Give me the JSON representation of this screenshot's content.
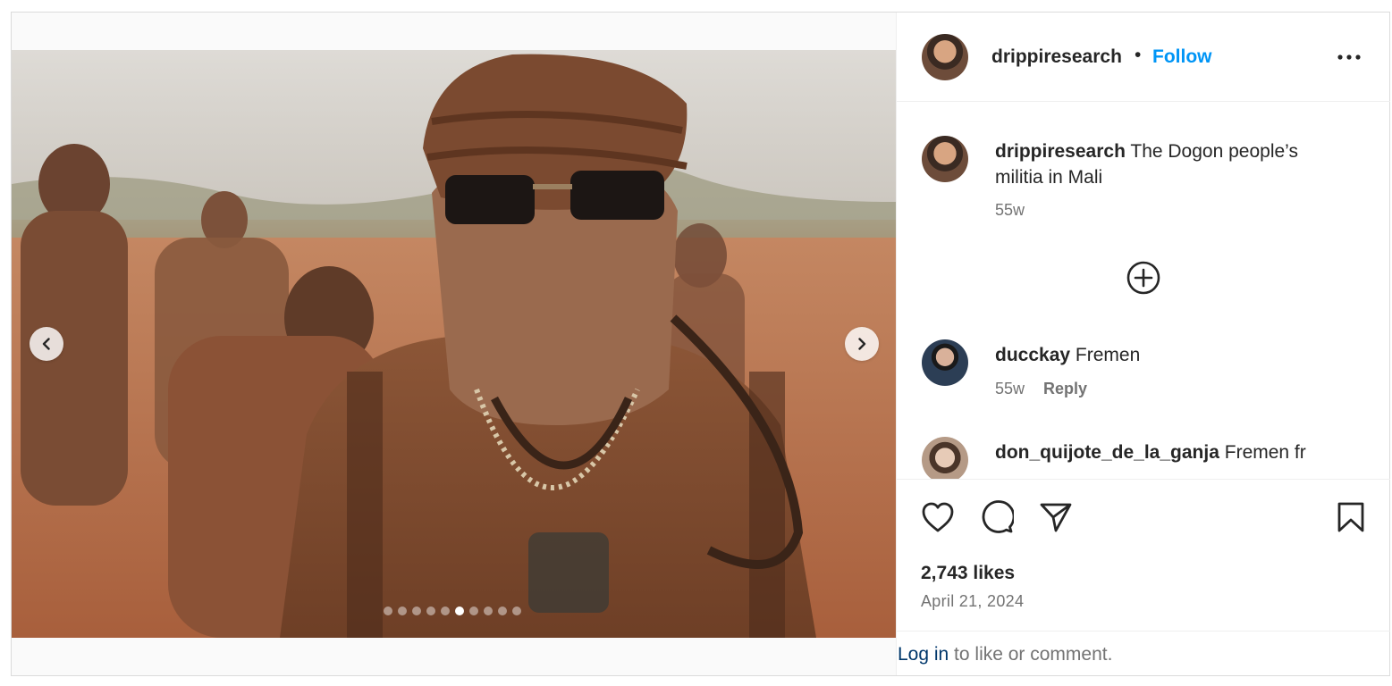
{
  "post": {
    "author": "drippiresearch",
    "separator": "•",
    "follow_label": "Follow",
    "caption": {
      "username": "drippiresearch",
      "text": "The Dogon people’s militia in Mali",
      "time": "55w"
    },
    "comments": [
      {
        "username": "ducckay",
        "text": "Fremen",
        "time": "55w",
        "reply_label": "Reply"
      },
      {
        "username": "don_quijote_de_la_ganja",
        "text": "Fremen fr"
      }
    ],
    "likes": "2,743 likes",
    "date": "April 21, 2024",
    "login_link": "Log in",
    "login_text": " to like or comment.",
    "carousel": {
      "slide_count": 10,
      "active_index": 5
    }
  },
  "icons": {
    "prev": "chevron-left-icon",
    "next": "chevron-right-icon",
    "more": "more-horizontal-icon",
    "load_more": "plus-circle-icon",
    "like": "heart-icon",
    "comment": "comment-bubble-icon",
    "share": "paper-plane-icon",
    "save": "bookmark-icon"
  },
  "colors": {
    "follow": "#0095f6",
    "login_link": "#00376b",
    "secondary_text": "#737373"
  }
}
